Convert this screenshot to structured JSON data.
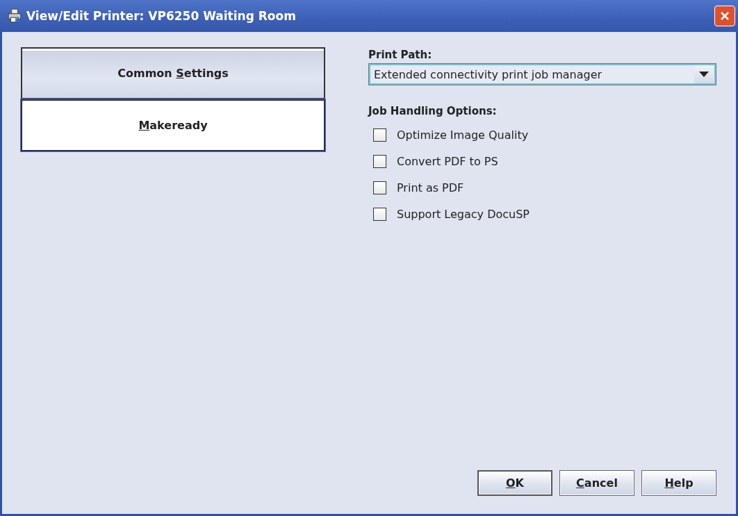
{
  "window": {
    "title": "View/Edit Printer: VP6250 Waiting Room"
  },
  "tabs": [
    {
      "pre": "Common ",
      "key": "S",
      "post": "ettings",
      "selected": true
    },
    {
      "key": "M",
      "post": "akeready",
      "selected": false
    }
  ],
  "print_path": {
    "label": "Print Path:",
    "value": "Extended connectivity print job manager"
  },
  "job_handling": {
    "label": "Job Handling Options:",
    "options": [
      {
        "label": "Optimize Image Quality",
        "checked": false
      },
      {
        "label": "Convert PDF to PS",
        "checked": false
      },
      {
        "label": "Print as PDF",
        "checked": false
      },
      {
        "label": "Support Legacy DocuSP",
        "checked": false
      }
    ]
  },
  "buttons": [
    {
      "key": "O",
      "post": "K",
      "default": true
    },
    {
      "key": "C",
      "post": "ancel",
      "default": false
    },
    {
      "key": "H",
      "post": "elp",
      "default": false
    }
  ]
}
